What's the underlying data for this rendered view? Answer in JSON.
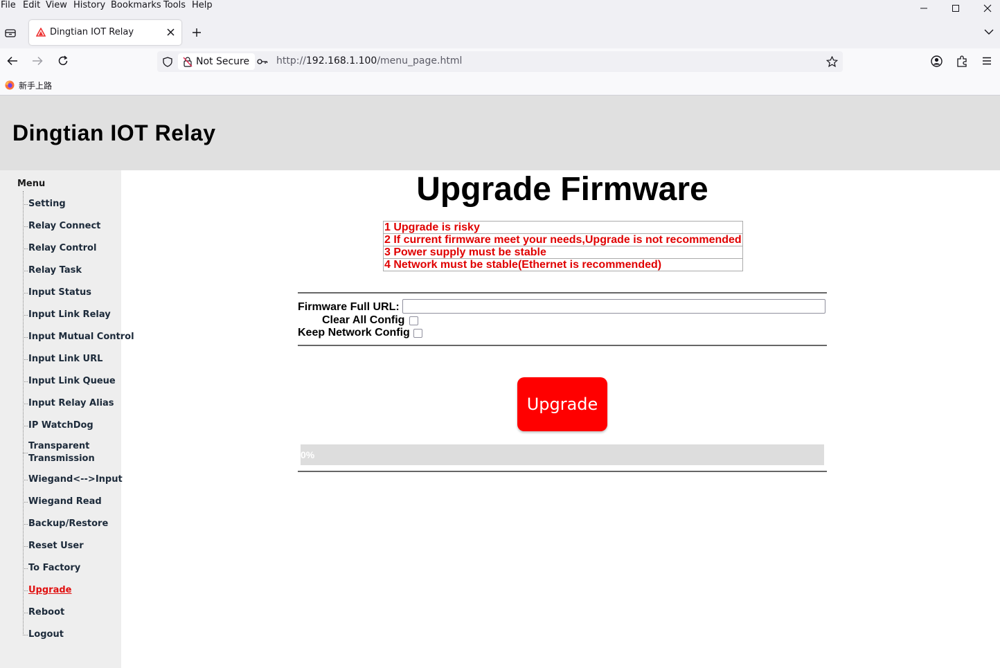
{
  "browser": {
    "menu": [
      "File",
      "Edit",
      "View",
      "History",
      "Bookmarks",
      "Tools",
      "Help"
    ],
    "tab_title": "Dingtian IOT Relay",
    "security_label": "Not Secure",
    "url_scheme": "http://",
    "url_host": "192.168.1.100",
    "url_path": "/menu_page.html",
    "bookmark_label": "新手上路"
  },
  "header": {
    "title": "Dingtian IOT Relay"
  },
  "sidebar": {
    "heading": "Menu",
    "items": [
      {
        "label": "Setting"
      },
      {
        "label": "Relay Connect"
      },
      {
        "label": "Relay Control"
      },
      {
        "label": "Relay Task"
      },
      {
        "label": "Input Status"
      },
      {
        "label": "Input Link Relay"
      },
      {
        "label": "Input Mutual Control"
      },
      {
        "label": "Input Link URL"
      },
      {
        "label": "Input Link Queue"
      },
      {
        "label": "Input Relay Alias"
      },
      {
        "label": "IP WatchDog"
      },
      {
        "label": "Transparent"
      },
      {
        "label": "Transmission"
      },
      {
        "label": "Wiegand<-->Input"
      },
      {
        "label": "Wiegand Read"
      },
      {
        "label": "Backup/Restore"
      },
      {
        "label": "Reset User"
      },
      {
        "label": "To Factory"
      },
      {
        "label": "Upgrade"
      },
      {
        "label": "Reboot"
      },
      {
        "label": "Logout"
      }
    ],
    "active": "Upgrade"
  },
  "main": {
    "title": "Upgrade Firmware",
    "warnings": [
      "1 Upgrade is risky",
      "2 If current firmware meet your needs,Upgrade is not recommended",
      "3 Power supply must be stable",
      "4 Network must be stable(Ethernet is recommended)"
    ],
    "firmware_url_label": "Firmware Full URL:",
    "firmware_url_value": "",
    "clear_config_label": "Clear All Config",
    "keep_network_label": "Keep Network Config",
    "upgrade_button": "Upgrade",
    "progress_text": "0%",
    "progress_value": 0
  },
  "colors": {
    "warning": "#e00000",
    "button": "#ff0000",
    "active_menu": "#e01010"
  }
}
